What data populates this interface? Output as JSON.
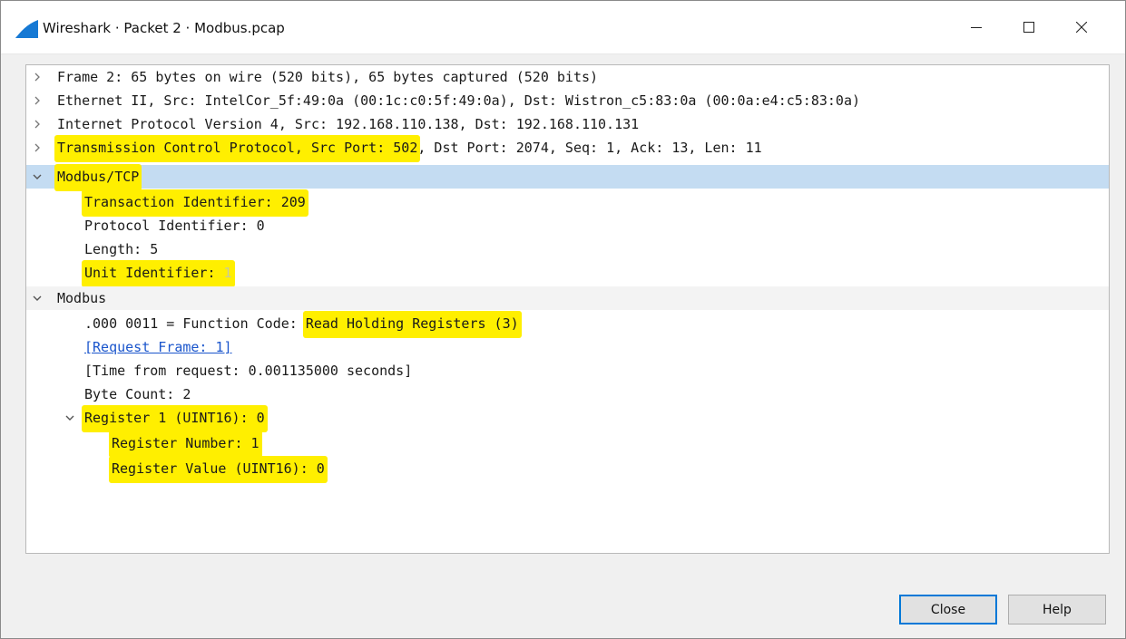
{
  "window": {
    "title": "Wireshark · Packet 2 · Modbus.pcap",
    "icons": {
      "app": "shark-fin-icon",
      "minimize": "minimize-icon",
      "maximize": "maximize-icon",
      "close": "close-icon"
    }
  },
  "tree": {
    "frame": "Frame 2: 65 bytes on wire (520 bits), 65 bytes captured (520 bits)",
    "ethernet": "Ethernet II, Src: IntelCor_5f:49:0a (00:1c:c0:5f:49:0a), Dst: Wistron_c5:83:0a (00:0a:e4:c5:83:0a)",
    "ipv4": "Internet Protocol Version 4, Src: 192.168.110.138, Dst: 192.168.110.131",
    "tcp_highlighted": "Transmission Control Protocol, Src Port: 502",
    "tcp_rest": ", Dst Port: 2074, Seq: 1, Ack: 13, Len: 11",
    "modbus_tcp": "Modbus/TCP",
    "transaction_id": "Transaction Identifier: 209",
    "protocol_id": "Protocol Identifier: 0",
    "length": "Length: 5",
    "unit_id_label": "Unit Identifier: ",
    "unit_id_value": "1",
    "modbus": "Modbus",
    "function_code_prefix": ".000 0011 = Function Code: ",
    "function_code_value": "Read Holding Registers (3)",
    "request_frame": "[Request Frame: 1]",
    "time_from_request": "[Time from request: 0.001135000 seconds]",
    "byte_count": "Byte Count: 2",
    "register": "Register 1 (UINT16): 0",
    "register_number": "Register Number: 1",
    "register_value": "Register Value (UINT16): 0"
  },
  "buttons": {
    "close": "Close",
    "help": "Help"
  },
  "colors": {
    "highlight": "#ffef00",
    "selected_row": "#c4dcf2",
    "link": "#1a55cc"
  }
}
